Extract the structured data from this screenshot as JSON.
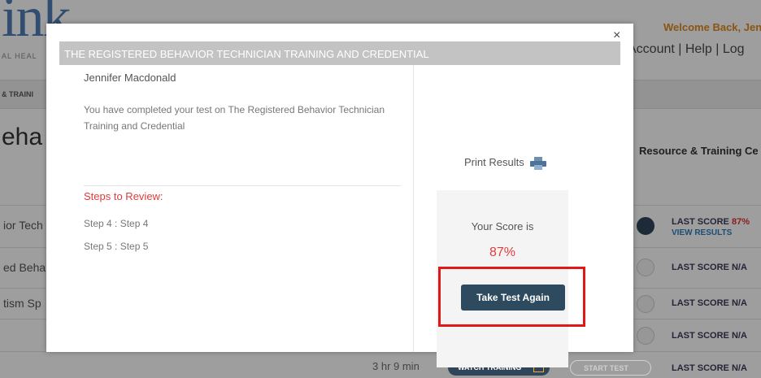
{
  "background": {
    "logo_text": "ink",
    "logo_sub": "AL HEAL",
    "welcome": "Welcome Back, Jenn",
    "account_links": "Account | Help | Log",
    "nav_item": "& TRAINI",
    "heading_fragment": "eha",
    "resource_heading": "Resource & Training Ce",
    "rows": [
      {
        "course": "ior Tech",
        "score_label": "LAST SCORE",
        "score_value": "87%",
        "view_results": "VIEW RESULTS"
      },
      {
        "course": "ed Beha",
        "score_label": "LAST SCORE",
        "score_value": "N/A"
      },
      {
        "course": "tism Sp",
        "score_label": "LAST SCORE",
        "score_value": "N/A"
      },
      {
        "course": "",
        "score_label": "LAST SCORE",
        "score_value": "N/A"
      },
      {
        "duration": "3 hr 9 min",
        "watch_label": "WATCH TRAINING",
        "start_label": "START TEST",
        "score_label": "LAST SCORE",
        "score_value": "N/A"
      }
    ]
  },
  "modal": {
    "close_glyph": "×",
    "title": "THE REGISTERED BEHAVIOR TECHNICIAN TRAINING AND CREDENTIAL",
    "user_name": "Jennifer Macdonald",
    "completed_message": "You have completed your test on The Registered Behavior Technician Training and Credential",
    "steps_heading": "Steps to Review:",
    "steps": [
      "Step 4 : Step 4",
      "Step 5 : Step 5"
    ],
    "print_label": "Print Results",
    "score_label": "Your Score is",
    "score_value": "87%",
    "retake_label": "Take Test Again"
  },
  "colors": {
    "accent_red": "#e23b3b",
    "button_dark": "#2e4a5f",
    "welcome_orange": "#e0891f",
    "highlight": "#e01818"
  },
  "icons": [
    "close-icon",
    "printer-icon",
    "play-icon"
  ]
}
